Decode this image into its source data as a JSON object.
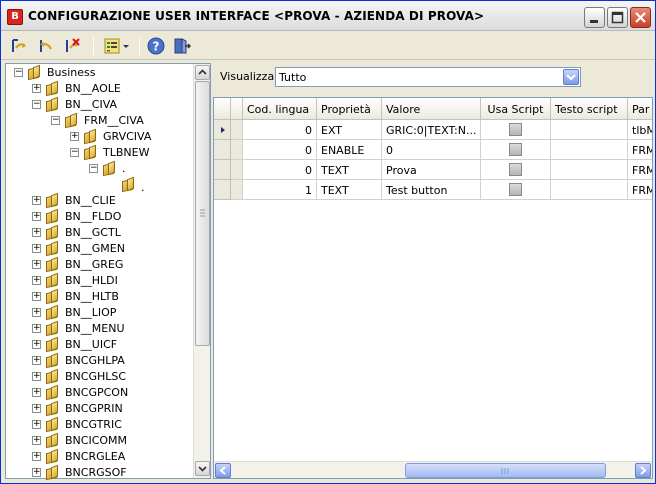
{
  "window": {
    "title": "CONFIGURAZIONE USER INTERFACE <PROVA - AZIENDA DI PROVA>",
    "app_icon_letter": "B"
  },
  "toolbar": {
    "buttons": [
      {
        "name": "save-icon"
      },
      {
        "name": "undo-icon"
      },
      {
        "name": "cancel-icon"
      },
      {
        "name": "list-view-icon"
      },
      {
        "name": "help-icon"
      },
      {
        "name": "exit-icon"
      }
    ]
  },
  "tree": {
    "nodes": [
      {
        "label": "Business",
        "level": 0,
        "expander": "−"
      },
      {
        "label": "BN__AOLE",
        "level": 1,
        "expander": "+"
      },
      {
        "label": "BN__CIVA",
        "level": 1,
        "expander": "−"
      },
      {
        "label": "FRM__CIVA",
        "level": 2,
        "expander": "−"
      },
      {
        "label": "GRVCIVA",
        "level": 3,
        "expander": "+"
      },
      {
        "label": "TLBNEW",
        "level": 3,
        "expander": "−"
      },
      {
        "label": ".",
        "level": 4,
        "expander": "−"
      },
      {
        "label": ".",
        "level": 5,
        "expander": ""
      },
      {
        "label": "BN__CLIE",
        "level": 1,
        "expander": "+"
      },
      {
        "label": "BN__FLDO",
        "level": 1,
        "expander": "+"
      },
      {
        "label": "BN__GCTL",
        "level": 1,
        "expander": "+"
      },
      {
        "label": "BN__GMEN",
        "level": 1,
        "expander": "+"
      },
      {
        "label": "BN__GREG",
        "level": 1,
        "expander": "+"
      },
      {
        "label": "BN__HLDI",
        "level": 1,
        "expander": "+"
      },
      {
        "label": "BN__HLTB",
        "level": 1,
        "expander": "+"
      },
      {
        "label": "BN__LIOP",
        "level": 1,
        "expander": "+"
      },
      {
        "label": "BN__MENU",
        "level": 1,
        "expander": "+"
      },
      {
        "label": "BN__UICF",
        "level": 1,
        "expander": "+"
      },
      {
        "label": "BNCGHLPA",
        "level": 1,
        "expander": "+"
      },
      {
        "label": "BNCGHLSC",
        "level": 1,
        "expander": "+"
      },
      {
        "label": "BNCGPCON",
        "level": 1,
        "expander": "+"
      },
      {
        "label": "BNCGPRIN",
        "level": 1,
        "expander": "+"
      },
      {
        "label": "BNCGTRIC",
        "level": 1,
        "expander": "+"
      },
      {
        "label": "BNCICOMM",
        "level": 1,
        "expander": "+"
      },
      {
        "label": "BNCRGLEA",
        "level": 1,
        "expander": "+"
      },
      {
        "label": "BNCRGSOF",
        "level": 1,
        "expander": "+"
      }
    ]
  },
  "filter": {
    "label": "Visualizza",
    "value": "Tutto"
  },
  "grid": {
    "columns": [
      "Cod. lingua",
      "Proprietà",
      "Valore",
      "Usa Script",
      "Testo script",
      "Parent"
    ],
    "columns_visible": [
      "Cod. lingua",
      "Proprietà",
      "Valore",
      "Usa Script",
      "Testo script",
      "Par"
    ],
    "rows": [
      {
        "cod_lingua": "0",
        "proprieta": "EXT",
        "valore": "GRIC:0|TEXT:N...",
        "usa_script": false,
        "testo_script": "",
        "parent": "tlbM"
      },
      {
        "cod_lingua": "0",
        "proprieta": "ENABLE",
        "valore": "0",
        "usa_script": false,
        "testo_script": "",
        "parent": "FRM"
      },
      {
        "cod_lingua": "0",
        "proprieta": "TEXT",
        "valore": "Prova",
        "usa_script": false,
        "testo_script": "",
        "parent": "FRM"
      },
      {
        "cod_lingua": "1",
        "proprieta": "TEXT",
        "valore": "Test button",
        "usa_script": false,
        "testo_script": "",
        "parent": "FRM"
      }
    ],
    "current_row": 0
  },
  "colors": {
    "title_bar_bg": "#e8e8e8",
    "window_bg": "#ece9d8",
    "accent_blue": "#7d9be6",
    "close_red": "#c8402b"
  }
}
